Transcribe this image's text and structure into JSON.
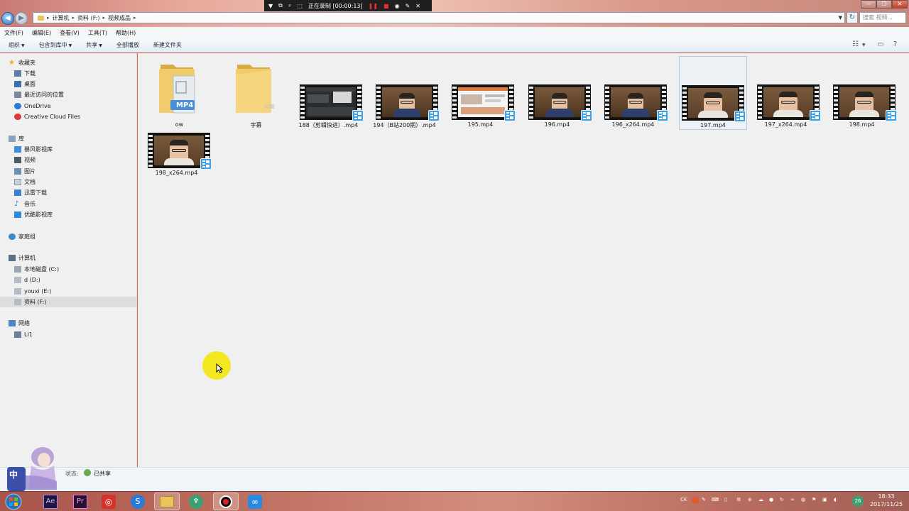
{
  "window": {
    "breadcrumbs": [
      "计算机",
      "资料 (F:)",
      "视频成品"
    ],
    "search_placeholder": "搜索 视频..."
  },
  "recording": {
    "status": "正在录制 [00:00:13]"
  },
  "menu": [
    "文件(F)",
    "编辑(E)",
    "查看(V)",
    "工具(T)",
    "帮助(H)"
  ],
  "commands": {
    "organize": "组织",
    "include_library": "包含到库中",
    "share": "共享",
    "play_all": "全部播放",
    "new_folder": "新建文件夹"
  },
  "nav": {
    "favorites": "收藏夹",
    "downloads": "下载",
    "desktop": "桌面",
    "recent": "最近访问的位置",
    "onedrive": "OneDrive",
    "creative_cloud": "Creative Cloud Files",
    "libraries": "库",
    "baofeng": "暴风影视库",
    "videos": "视频",
    "pictures": "图片",
    "documents": "文档",
    "xunlei": "迅雷下载",
    "music": "音乐",
    "youku": "优酷影视库",
    "homegroup": "家庭组",
    "computer": "计算机",
    "drive_c": "本地磁盘 (C:)",
    "drive_d": "d (D:)",
    "drive_e": "youxi (E:)",
    "drive_f": "资料 (F:)",
    "network": "网络",
    "network_pc": "LI1"
  },
  "files": [
    {
      "name": "ow",
      "type": "folder-mp4"
    },
    {
      "name": "字幕",
      "type": "folder"
    },
    {
      "name": "188（剪辑快进）.mp4",
      "type": "video-editor"
    },
    {
      "name": "194（B站200期）.mp4",
      "type": "video-person"
    },
    {
      "name": "195.mp4",
      "type": "video-web"
    },
    {
      "name": "196.mp4",
      "type": "video-person"
    },
    {
      "name": "196_x264.mp4",
      "type": "video-person"
    },
    {
      "name": "197.mp4",
      "type": "video-closeup",
      "selected": true
    },
    {
      "name": "197_x264.mp4",
      "type": "video-closeup"
    },
    {
      "name": "198.mp4",
      "type": "video-closeup"
    },
    {
      "name": "198_x264.mp4",
      "type": "video-closeup"
    }
  ],
  "folder_badge": "MP4",
  "status": {
    "label": "状态:",
    "value": "已共享"
  },
  "ime": "中",
  "taskbar": {
    "apps": [
      "start",
      "Ae",
      "Pr",
      "netease-music",
      "sogou",
      "explorer",
      "game",
      "recorder",
      "baidu-netdisk"
    ],
    "ae_label": "Ae",
    "pr_label": "Pr",
    "tray_lang": "CK",
    "tray_badge": "26"
  },
  "clock": {
    "time": "18:33",
    "date": "2017/11/25"
  },
  "colors": {
    "accent_blue": "#3aa0e8",
    "folder_yellow": "#e9c45b",
    "cursor_highlight": "#f3e720"
  }
}
